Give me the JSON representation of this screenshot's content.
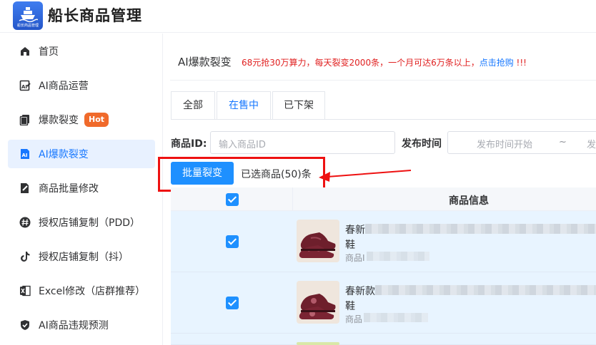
{
  "app": {
    "title": "船长商品管理",
    "logo_sub": "船长商品管理"
  },
  "sidebar": {
    "items": [
      {
        "label": "首页",
        "icon": "home-icon"
      },
      {
        "label": "AI商品运营",
        "icon": "ai-edit-icon"
      },
      {
        "label": "爆款裂变",
        "icon": "copy-icon",
        "badge": "Hot"
      },
      {
        "label": "AI爆款裂变",
        "icon": "ai-doc-icon",
        "active": true
      },
      {
        "label": "商品批量修改",
        "icon": "edit-icon"
      },
      {
        "label": "授权店铺复制（PDD）",
        "icon": "hash-icon"
      },
      {
        "label": "授权店铺复制（抖）",
        "icon": "tiktok-icon"
      },
      {
        "label": "Excel修改（店群推荐）",
        "icon": "excel-icon"
      },
      {
        "label": "AI商品违规预测",
        "icon": "shield-check-icon"
      }
    ]
  },
  "main": {
    "title": "AI爆款裂变",
    "promo": "68元抢30万算力，每天裂变2000条，一个月可达6万条以上，",
    "promo_link": "点击抢购",
    "promo_tail": " !!!",
    "tabs": [
      {
        "label": "全部"
      },
      {
        "label": "在售中",
        "active": true
      },
      {
        "label": "已下架"
      }
    ],
    "filters": {
      "product_id_label": "商品ID:",
      "product_id_placeholder": "输入商品ID",
      "publish_time_label": "发布时间",
      "time_start_placeholder": "发布时间开始",
      "time_sep": "~",
      "time_end_placeholder": "发"
    },
    "batch_button": "批量裂变",
    "selected_text": "已选商品(50)条",
    "table": {
      "header": "商品信息",
      "rows": [
        {
          "name_prefix": "春新",
          "name_line2": "鞋",
          "id_prefix": "商品I",
          "checked": true
        },
        {
          "name_prefix": "春新款",
          "name_line2": "鞋",
          "id_prefix": "商品",
          "checked": true
        }
      ]
    }
  },
  "colors": {
    "accent": "#1677ff",
    "button": "#1e90ff",
    "promo": "#e02020",
    "annotation": "#ee1111",
    "hot": "#f06a2b"
  }
}
